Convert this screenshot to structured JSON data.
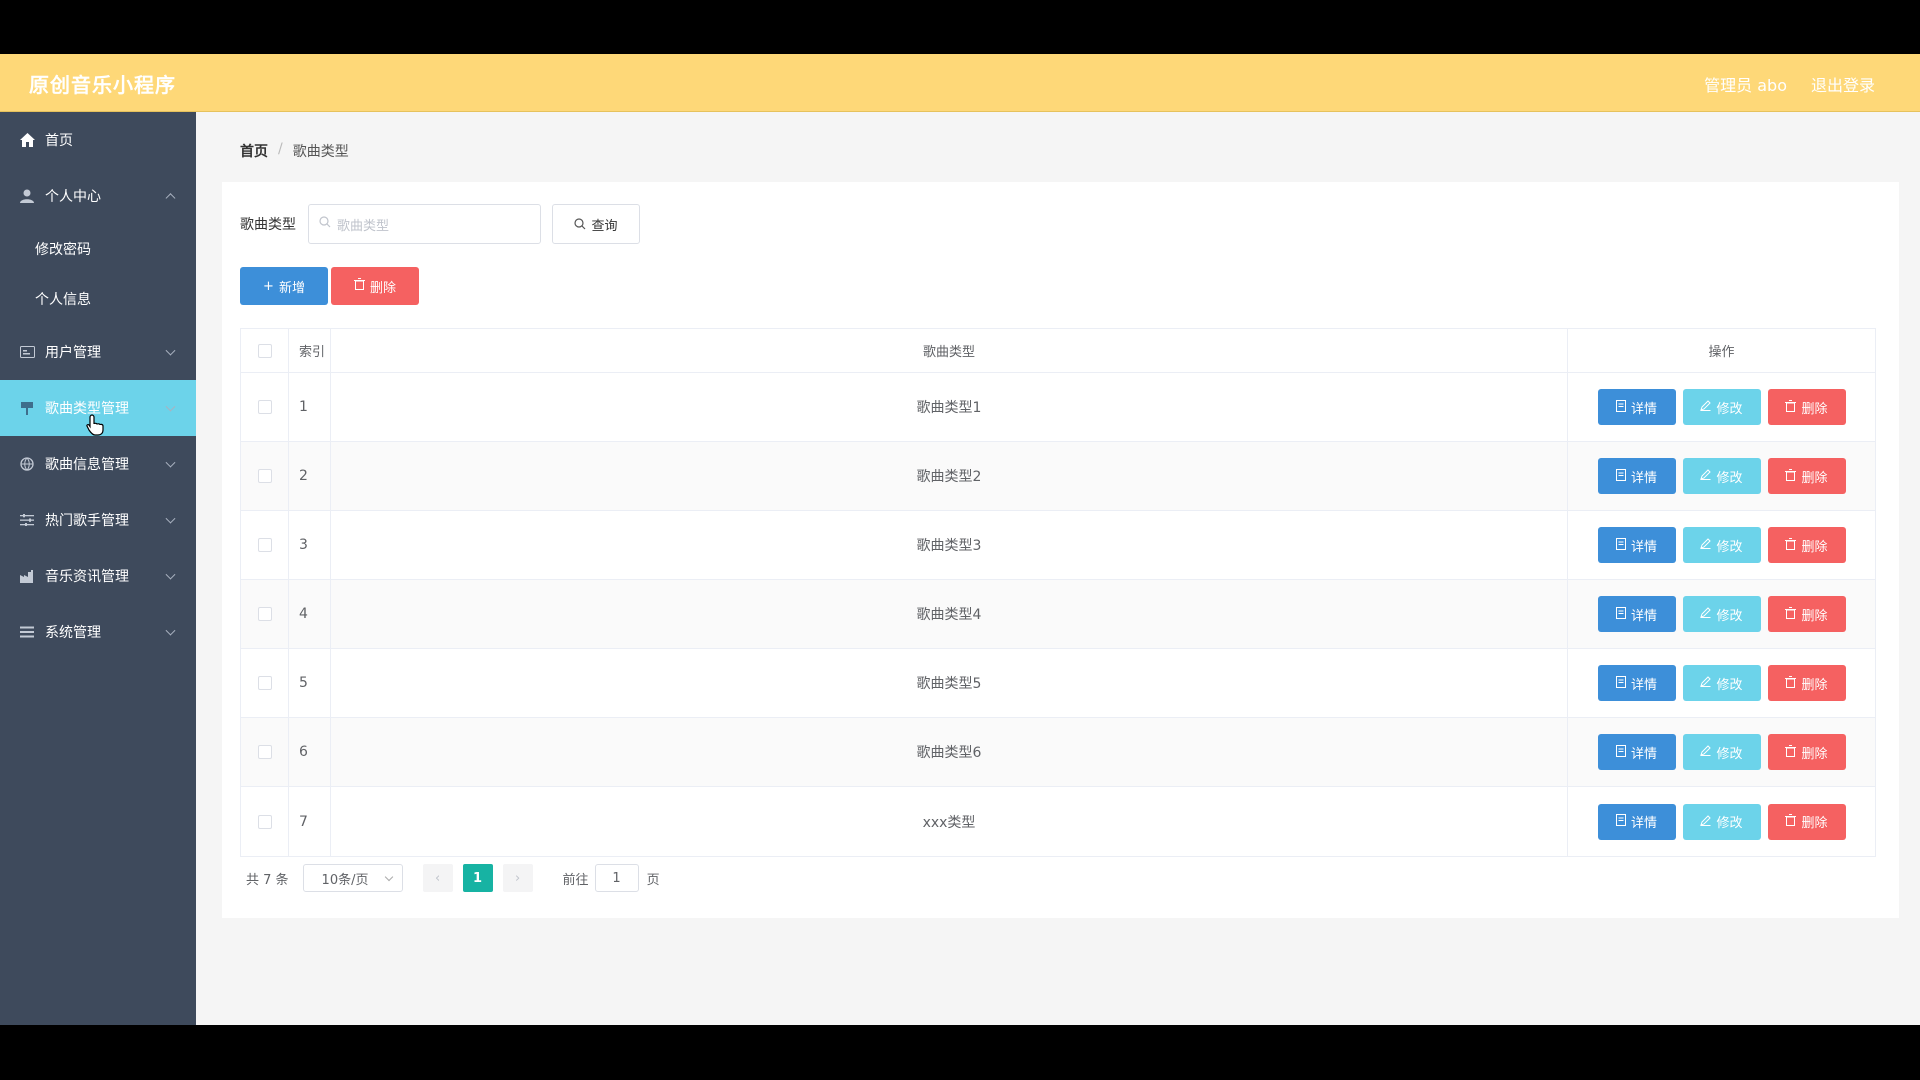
{
  "header": {
    "title": "原创音乐小程序",
    "user": "管理员 abo",
    "logout": "退出登录"
  },
  "sidebar": {
    "items": [
      {
        "label": "首页"
      },
      {
        "label": "个人中心",
        "children": [
          {
            "label": "修改密码"
          },
          {
            "label": "个人信息"
          }
        ]
      },
      {
        "label": "用户管理"
      },
      {
        "label": "歌曲类型管理"
      },
      {
        "label": "歌曲信息管理"
      },
      {
        "label": "热门歌手管理"
      },
      {
        "label": "音乐资讯管理"
      },
      {
        "label": "系统管理"
      }
    ]
  },
  "breadcrumb": {
    "home": "首页",
    "sep": "/",
    "current": "歌曲类型"
  },
  "search": {
    "label": "歌曲类型",
    "placeholder": "歌曲类型",
    "button": "查询"
  },
  "actions": {
    "add": "新增",
    "delete": "删除"
  },
  "table": {
    "headers": {
      "index": "索引",
      "type": "歌曲类型",
      "ops": "操作"
    },
    "rows": [
      {
        "index": "1",
        "type": "歌曲类型1"
      },
      {
        "index": "2",
        "type": "歌曲类型2"
      },
      {
        "index": "3",
        "type": "歌曲类型3"
      },
      {
        "index": "4",
        "type": "歌曲类型4"
      },
      {
        "index": "5",
        "type": "歌曲类型5"
      },
      {
        "index": "6",
        "type": "歌曲类型6"
      },
      {
        "index": "7",
        "type": "xxx类型"
      }
    ],
    "op_labels": {
      "detail": "详情",
      "edit": "修改",
      "delete": "删除"
    }
  },
  "pagination": {
    "total": "共 7 条",
    "page_size": "10条/页",
    "current": "1",
    "goto": "前往",
    "goto_value": "1",
    "unit": "页"
  },
  "colors": {
    "header": "#fed878",
    "sidebar": "#3e4a5c",
    "active": "#6cd3ea",
    "primary": "#3d8fd9",
    "danger": "#f56161",
    "pager_active": "#17b3a3"
  }
}
